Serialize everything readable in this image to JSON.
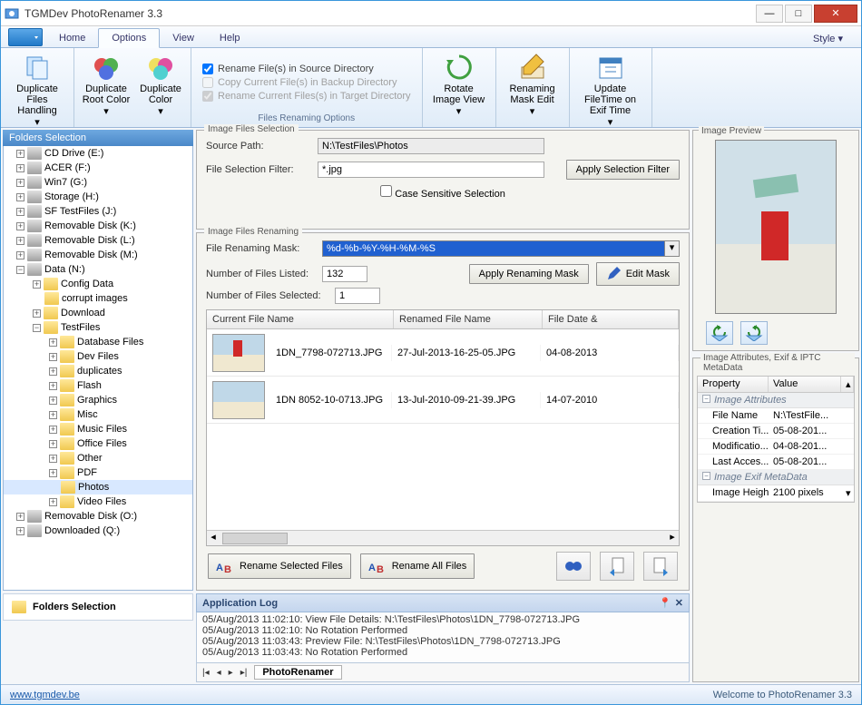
{
  "title": "TGMDev PhotoRenamer 3.3",
  "menu": {
    "home": "Home",
    "options": "Options",
    "view": "View",
    "help": "Help",
    "style": "Style"
  },
  "ribbon": {
    "dup_files": "Duplicate Files Handling",
    "dup_root": "Duplicate Root Color",
    "dup_color": "Duplicate Color",
    "opt1": "Rename File(s) in Source Directory",
    "opt2": "Copy Current File(s) in Backup Directory",
    "opt3": "Rename Current Files(s) in Target Directory",
    "group_label": "Files Renaming Options",
    "rotate": "Rotate Image View",
    "mask_edit": "Renaming Mask Edit",
    "filetime": "Update FileTime on Exif Time"
  },
  "sidebar_title": "Folders Selection",
  "tree": [
    {
      "l": 0,
      "exp": "+",
      "ic": "drive",
      "t": "CD Drive (E:)"
    },
    {
      "l": 0,
      "exp": "+",
      "ic": "drive",
      "t": "ACER (F:)"
    },
    {
      "l": 0,
      "exp": "+",
      "ic": "drive",
      "t": "Win7 (G:)"
    },
    {
      "l": 0,
      "exp": "+",
      "ic": "drive",
      "t": "Storage (H:)"
    },
    {
      "l": 0,
      "exp": "+",
      "ic": "drive",
      "t": "SF TestFiles (J:)"
    },
    {
      "l": 0,
      "exp": "+",
      "ic": "drive",
      "t": "Removable Disk (K:)"
    },
    {
      "l": 0,
      "exp": "+",
      "ic": "drive",
      "t": "Removable Disk (L:)"
    },
    {
      "l": 0,
      "exp": "+",
      "ic": "drive",
      "t": "Removable Disk (M:)"
    },
    {
      "l": 0,
      "exp": "−",
      "ic": "drive",
      "t": "Data (N:)"
    },
    {
      "l": 1,
      "exp": "+",
      "ic": "folder",
      "t": "Config Data"
    },
    {
      "l": 1,
      "exp": "",
      "ic": "folder",
      "t": "corrupt images"
    },
    {
      "l": 1,
      "exp": "+",
      "ic": "folder",
      "t": "Download"
    },
    {
      "l": 1,
      "exp": "−",
      "ic": "folder",
      "t": "TestFiles"
    },
    {
      "l": 2,
      "exp": "+",
      "ic": "folder",
      "t": "Database Files"
    },
    {
      "l": 2,
      "exp": "+",
      "ic": "folder",
      "t": "Dev Files"
    },
    {
      "l": 2,
      "exp": "+",
      "ic": "folder",
      "t": "duplicates"
    },
    {
      "l": 2,
      "exp": "+",
      "ic": "folder",
      "t": "Flash"
    },
    {
      "l": 2,
      "exp": "+",
      "ic": "folder",
      "t": "Graphics"
    },
    {
      "l": 2,
      "exp": "+",
      "ic": "folder",
      "t": "Misc"
    },
    {
      "l": 2,
      "exp": "+",
      "ic": "folder",
      "t": "Music Files"
    },
    {
      "l": 2,
      "exp": "+",
      "ic": "folder",
      "t": "Office Files"
    },
    {
      "l": 2,
      "exp": "+",
      "ic": "folder",
      "t": "Other"
    },
    {
      "l": 2,
      "exp": "+",
      "ic": "folder",
      "t": "PDF"
    },
    {
      "l": 2,
      "exp": "",
      "ic": "folder",
      "t": "Photos",
      "sel": true
    },
    {
      "l": 2,
      "exp": "+",
      "ic": "folder",
      "t": "Video Files"
    },
    {
      "l": 0,
      "exp": "+",
      "ic": "drive",
      "t": "Removable Disk (O:)"
    },
    {
      "l": 0,
      "exp": "+",
      "ic": "drive",
      "t": "Downloaded (Q:)"
    }
  ],
  "fs_footer": "Folders Selection",
  "sel": {
    "legend": "Image Files Selection",
    "src_lbl": "Source Path:",
    "src_val": "N:\\TestFiles\\Photos",
    "filter_lbl": "File Selection Filter:",
    "filter_val": "*.jpg",
    "apply": "Apply Selection Filter",
    "case": "Case Sensitive Selection"
  },
  "ren": {
    "legend": "Image Files Renaming",
    "mask_lbl": "File Renaming Mask:",
    "mask_val": "%d-%b-%Y-%H-%M-%S",
    "nlisted_lbl": "Number of Files Listed:",
    "nlisted_val": "132",
    "nsel_lbl": "Number of Files Selected:",
    "nsel_val": "1",
    "apply_mask": "Apply Renaming Mask",
    "edit_mask": "Edit Mask"
  },
  "grid": {
    "h1": "Current File Name",
    "h2": "Renamed File Name",
    "h3": "File Date & ",
    "rows": [
      {
        "cur": "1DN_7798-072713.JPG",
        "ren": "27-Jul-2013-16-25-05.JPG",
        "dt": "04-08-2013"
      },
      {
        "cur": "1DN  8052-10-0713.JPG",
        "ren": "13-Jul-2010-09-21-39.JPG",
        "dt": "14-07-2010"
      }
    ]
  },
  "actions": {
    "rename_sel": "Rename Selected Files",
    "rename_all": "Rename All Files"
  },
  "log": {
    "title": "Application Log",
    "lines": [
      "05/Aug/2013 11:02:10: View File Details: N:\\TestFiles\\Photos\\1DN_7798-072713.JPG",
      "05/Aug/2013 11:02:10: No Rotation Performed",
      "05/Aug/2013 11:03:43: Preview File: N:\\TestFiles\\Photos\\1DN_7798-072713.JPG",
      "05/Aug/2013 11:03:43: No Rotation Performed"
    ],
    "tab": "PhotoRenamer"
  },
  "preview_legend": "Image Preview",
  "attrs": {
    "legend": "Image Attributes, Exif & IPTC MetaData",
    "h1": "Property",
    "h2": "Value",
    "sec1": "Image Attributes",
    "rows1": [
      {
        "p": "File Name",
        "v": "N:\\TestFile..."
      },
      {
        "p": "Creation Ti...",
        "v": "05-08-201..."
      },
      {
        "p": "Modificatio...",
        "v": "04-08-201..."
      },
      {
        "p": "Last Acces...",
        "v": "05-08-201..."
      }
    ],
    "sec2": "Image Exif MetaData",
    "rows2": [
      {
        "p": "Image Height",
        "v": "2100 pixels"
      }
    ]
  },
  "status": {
    "link": "www.tgmdev.be",
    "right": "Welcome to PhotoRenamer 3.3"
  }
}
